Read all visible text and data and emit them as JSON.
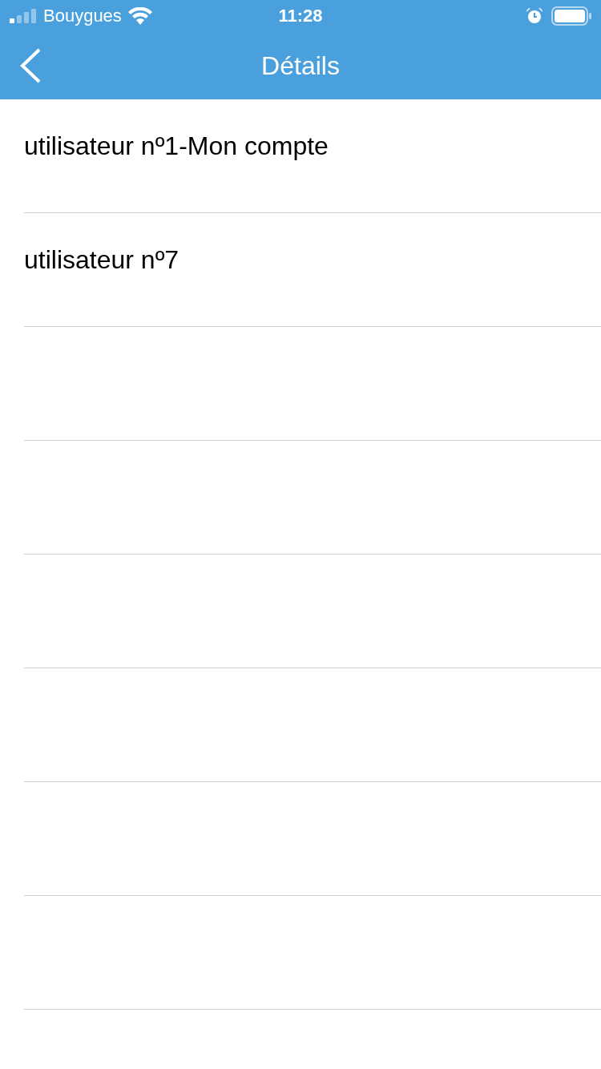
{
  "status_bar": {
    "carrier": "Bouygues",
    "time": "11:28"
  },
  "nav_bar": {
    "title": "Détails"
  },
  "list": [
    {
      "label": "utilisateur nº1-Mon compte"
    },
    {
      "label": "utilisateur nº7"
    }
  ]
}
